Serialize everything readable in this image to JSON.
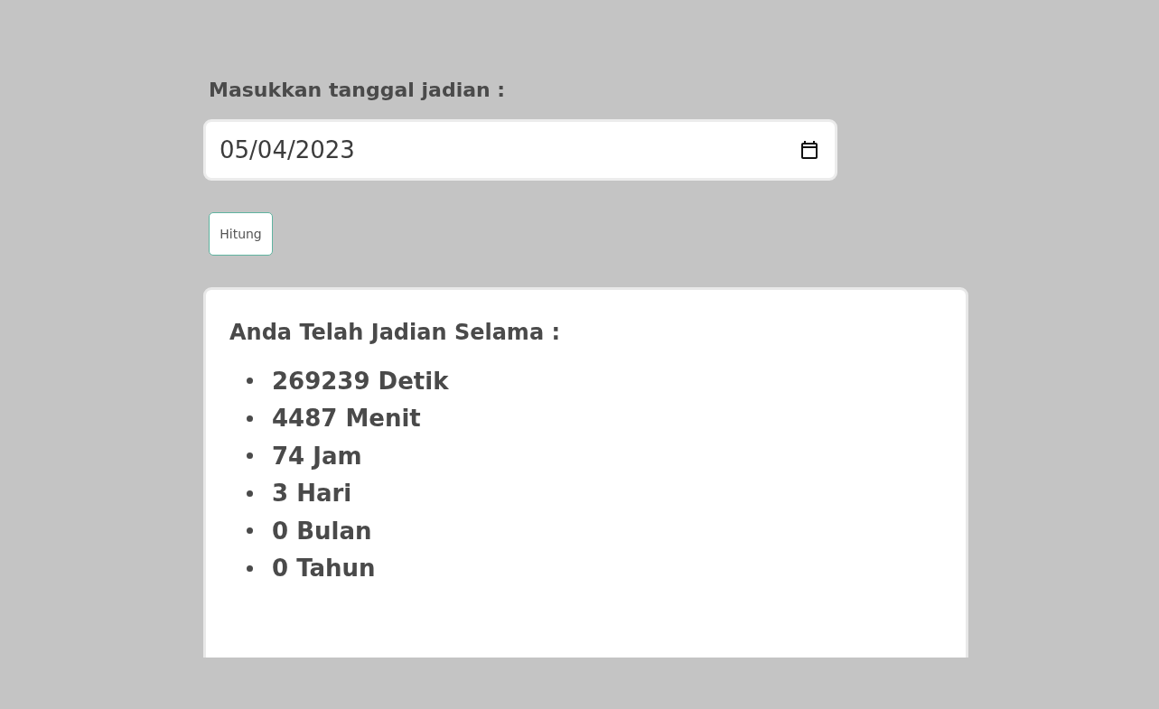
{
  "form": {
    "label": "Masukkan tanggal jadian :",
    "date_value": "05/04/2023",
    "button": "Hitung"
  },
  "result": {
    "heading": "Anda Telah Jadian Selama :",
    "items": [
      "269239 Detik",
      "4487 Menit",
      "74 Jam",
      "3 Hari",
      "0 Bulan",
      "0 Tahun"
    ]
  }
}
